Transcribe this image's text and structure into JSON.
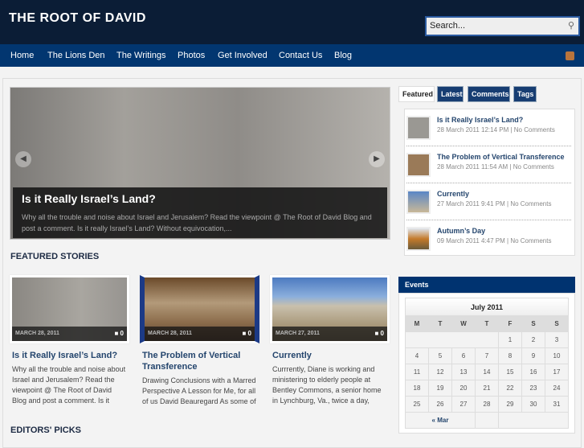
{
  "site": {
    "title": "THE ROOT OF DAVID",
    "search_placeholder": "Search..."
  },
  "nav": [
    "Home",
    "The Lions Den",
    "The Writings",
    "Photos",
    "Get Involved",
    "Contact Us",
    "Blog"
  ],
  "slider": {
    "title": "Is it Really Israel’s Land?",
    "excerpt": "Why all the trouble and noise about Israel and Jerusalem? Read the viewpoint @ The Root of David Blog and post a comment. Is it really Israel’s Land? Without equivocation,..."
  },
  "featured_title": "FEATURED STORIES",
  "editors_title": "EDITORS' PICKS",
  "cards": [
    {
      "date": "MARCH 28, 2011",
      "comments": "0",
      "title": "Is it Really Israel’s Land?",
      "excerpt": "Why all the trouble and noise about Israel and Jerusalem? Read the viewpoint @ The Root of David Blog and post a comment. Is it really Israel’s Land?"
    },
    {
      "date": "MARCH 28, 2011",
      "comments": "0",
      "title": "The Problem of Vertical Transference",
      "excerpt": "Drawing Conclusions with a Marred Perspective A Lesson for Me, for all of us David Beauregard As some of"
    },
    {
      "date": "MARCH 27, 2011",
      "comments": "0",
      "title": "Currently",
      "excerpt": "Currrently, Diane is working and ministering to elderly people at Bentley Commons, a senior home in Lynchburg, Va., twice a day,"
    }
  ],
  "tabs": [
    "Featured",
    "Latest",
    "Comments",
    "Tags"
  ],
  "tab_items": [
    {
      "title": "Is it Really Israel’s Land?",
      "meta": "28 March 2011 12:14 PM | No Comments"
    },
    {
      "title": "The Problem of Vertical Transference",
      "meta": "28 March 2011 11:54 AM | No Comments"
    },
    {
      "title": "Currently",
      "meta": "27 March 2011 9:41 PM | No Comments"
    },
    {
      "title": "Autumn’s Day",
      "meta": "09 March 2011 4:47 PM | No Comments"
    }
  ],
  "events": {
    "title": "Events",
    "month": "July 2011",
    "days": [
      "M",
      "T",
      "W",
      "T",
      "F",
      "S",
      "S"
    ],
    "weeks": [
      [
        "",
        "",
        "",
        "",
        "1",
        "2",
        "3"
      ],
      [
        "4",
        "5",
        "6",
        "7",
        "8",
        "9",
        "10"
      ],
      [
        "11",
        "12",
        "13",
        "14",
        "15",
        "16",
        "17"
      ],
      [
        "18",
        "19",
        "20",
        "21",
        "22",
        "23",
        "24"
      ],
      [
        "25",
        "26",
        "27",
        "28",
        "29",
        "30",
        "31"
      ]
    ],
    "prev": "« Mar"
  }
}
